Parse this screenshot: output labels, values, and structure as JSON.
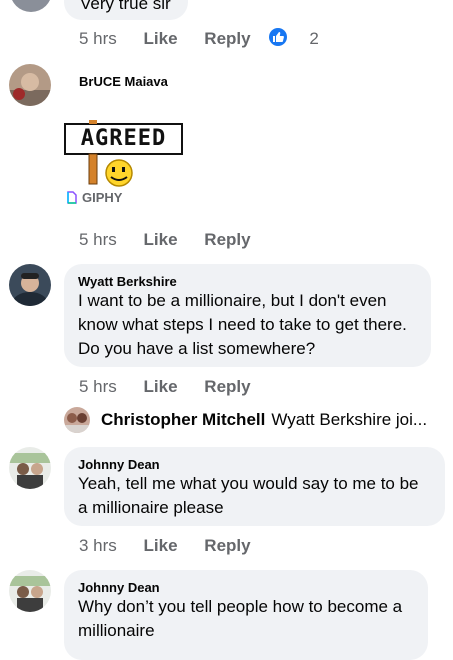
{
  "comments": [
    {
      "text": "Very true sir",
      "time": "5 hrs",
      "like": "Like",
      "reply": "Reply",
      "reactions": "2"
    },
    {
      "author": "BrUCE Maiava",
      "gif": {
        "sign_text": "AGREED",
        "source": "GIPHY"
      },
      "time": "5 hrs",
      "like": "Like",
      "reply": "Reply"
    },
    {
      "author": "Wyatt Berkshire",
      "lines": [
        "I want to be a millionaire, but I don't even",
        "know what steps I need to take to get there.",
        "Do you have a list somewhere?"
      ],
      "time": "5 hrs",
      "like": "Like",
      "reply": "Reply",
      "reply_preview": {
        "name": "Christopher Mitchell",
        "text": "Wyatt Berkshire joi..."
      }
    },
    {
      "author": "Johnny Dean",
      "lines": [
        "Yeah, tell me what you would say to me to be",
        "a millionaire please"
      ],
      "time": "3 hrs",
      "like": "Like",
      "reply": "Reply"
    },
    {
      "author": "Johnny Dean",
      "lines": [
        "Why don’t you tell people how to become a",
        "millionaire"
      ]
    }
  ],
  "colors": {
    "bubble": "#f0f2f5",
    "meta": "#65676b",
    "like_blue": "#1877f2"
  }
}
